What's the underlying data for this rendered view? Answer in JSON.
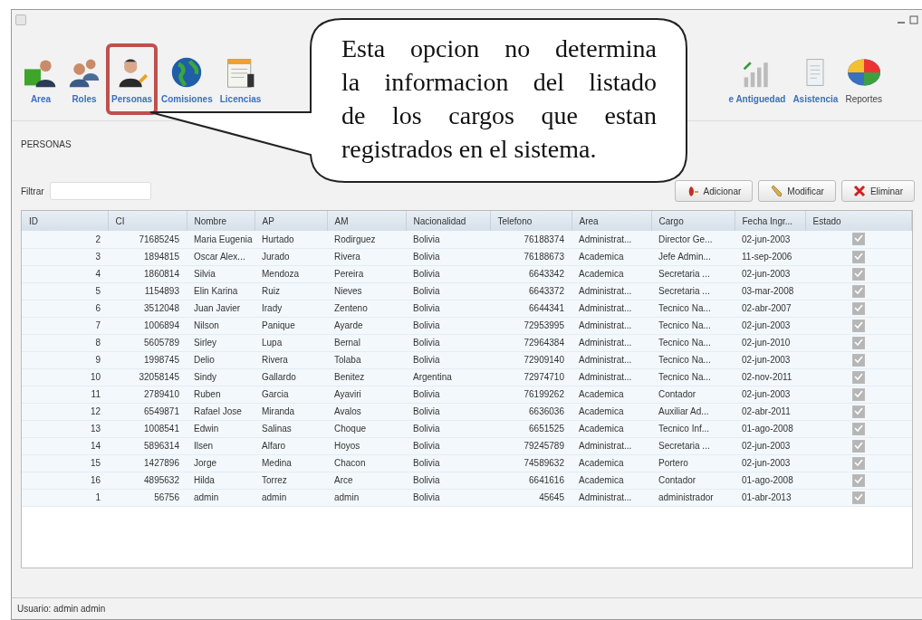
{
  "toolbar": {
    "items": [
      {
        "label": "Area",
        "selected": false
      },
      {
        "label": "Roles",
        "selected": false
      },
      {
        "label": "Personas",
        "selected": true
      },
      {
        "label": "Comisiones",
        "selected": false
      },
      {
        "label": "Licencias",
        "selected": false
      },
      {
        "label": "e Antiguedad",
        "selected": false
      },
      {
        "label": "Asistencia",
        "selected": false
      },
      {
        "label": "Reportes",
        "selected": false
      }
    ]
  },
  "callout": {
    "lines": [
      "Esta opcion no determina",
      "la informacion del listado",
      "de los cargos que estan",
      "registrados en el sistema."
    ]
  },
  "panel": {
    "title": "PERSONAS",
    "filter_label": "Filtrar",
    "buttons": [
      {
        "label": "Adicionar",
        "kind": "add"
      },
      {
        "label": "Modificar",
        "kind": "edit"
      },
      {
        "label": "Eliminar",
        "kind": "delete"
      }
    ]
  },
  "table": {
    "columns": [
      "ID",
      "CI",
      "Nombre",
      "AP",
      "AM",
      "Nacionalidad",
      "Telefono",
      "Area",
      "Cargo",
      "Fecha Ingr...",
      "Estado"
    ],
    "rows": [
      {
        "cells": [
          "2",
          "71685245",
          "Maria Eugenia",
          "Hurtado",
          "Rodirguez",
          "Bolivia",
          "76188374",
          "Administrat...",
          "Director Ge...",
          "02-jun-2003"
        ],
        "checked": true
      },
      {
        "cells": [
          "3",
          "1894815",
          "Oscar Alex...",
          "Jurado",
          "Rivera",
          "Bolivia",
          "76188673",
          "Academica",
          "Jefe Admin...",
          "11-sep-2006"
        ],
        "checked": true
      },
      {
        "cells": [
          "4",
          "1860814",
          "Silvia",
          "Mendoza",
          "Pereira",
          "Bolivia",
          "6643342",
          "Academica",
          "Secretaria ...",
          "02-jun-2003"
        ],
        "checked": true
      },
      {
        "cells": [
          "5",
          "1154893",
          "Elin Karina",
          "Ruiz",
          "Nieves",
          "Bolivia",
          "6643372",
          "Administrat...",
          "Secretaria ...",
          "03-mar-2008"
        ],
        "checked": true
      },
      {
        "cells": [
          "6",
          "3512048",
          "Juan Javier",
          "Irady",
          "Zenteno",
          "Bolivia",
          "6644341",
          "Administrat...",
          "Tecnico Na...",
          "02-abr-2007"
        ],
        "checked": true
      },
      {
        "cells": [
          "7",
          "1006894",
          "Nilson",
          "Panique",
          "Ayarde",
          "Bolivia",
          "72953995",
          "Administrat...",
          "Tecnico Na...",
          "02-jun-2003"
        ],
        "checked": true
      },
      {
        "cells": [
          "8",
          "5605789",
          "Sirley",
          "Lupa",
          "Bernal",
          "Bolivia",
          "72964384",
          "Administrat...",
          "Tecnico Na...",
          "02-jun-2010"
        ],
        "checked": true
      },
      {
        "cells": [
          "9",
          "1998745",
          "Delio",
          "Rivera",
          "Tolaba",
          "Bolivia",
          "72909140",
          "Administrat...",
          "Tecnico Na...",
          "02-jun-2003"
        ],
        "checked": true
      },
      {
        "cells": [
          "10",
          "32058145",
          "Sindy",
          "Gallardo",
          "Benitez",
          "Argentina",
          "72974710",
          "Administrat...",
          "Tecnico Na...",
          "02-nov-2011"
        ],
        "checked": true
      },
      {
        "cells": [
          "11",
          "2789410",
          "Ruben",
          "Garcia",
          "Ayaviri",
          "Bolivia",
          "76199262",
          "Academica",
          "Contador",
          "02-jun-2003"
        ],
        "checked": true
      },
      {
        "cells": [
          "12",
          "6549871",
          "Rafael Jose",
          "Miranda",
          "Avalos",
          "Bolivia",
          "6636036",
          "Academica",
          "Auxiliar Ad...",
          "02-abr-2011"
        ],
        "checked": true
      },
      {
        "cells": [
          "13",
          "1008541",
          "Edwin",
          "Salinas",
          "Choque",
          "Bolivia",
          "6651525",
          "Academica",
          "Tecnico Inf...",
          "01-ago-2008"
        ],
        "checked": true
      },
      {
        "cells": [
          "14",
          "5896314",
          "Ilsen",
          "Alfaro",
          "Hoyos",
          "Bolivia",
          "79245789",
          "Administrat...",
          "Secretaria ...",
          "02-jun-2003"
        ],
        "checked": true
      },
      {
        "cells": [
          "15",
          "1427896",
          "Jorge",
          "Medina",
          "Chacon",
          "Bolivia",
          "74589632",
          "Academica",
          "Portero",
          "02-jun-2003"
        ],
        "checked": true
      },
      {
        "cells": [
          "16",
          "4895632",
          "Hilda",
          "Torrez",
          "Arce",
          "Bolivia",
          "6641616",
          "Academica",
          "Contador",
          "01-ago-2008"
        ],
        "checked": true
      },
      {
        "cells": [
          "1",
          "56756",
          "admin",
          "admin",
          "admin",
          "Bolivia",
          "45645",
          "Administrat...",
          "administrador",
          "01-abr-2013"
        ],
        "checked": true
      }
    ]
  },
  "status_bar": {
    "text": "Usuario: admin admin"
  }
}
